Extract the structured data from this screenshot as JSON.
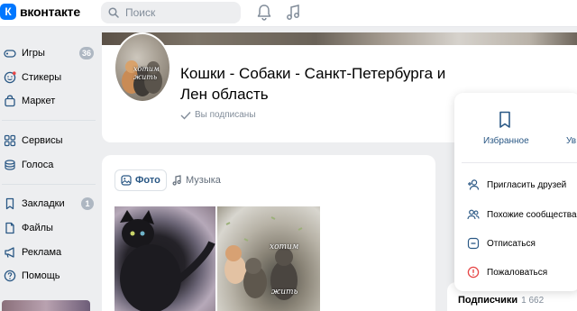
{
  "header": {
    "logo_text": "вконтакте",
    "logo_letter": "К",
    "search_placeholder": "Поиск"
  },
  "sidebar": {
    "items": [
      {
        "label": "Игры",
        "count": "36"
      },
      {
        "label": "Стикеры",
        "count": ""
      },
      {
        "label": "Маркет",
        "count": ""
      },
      {
        "label": "Сервисы",
        "count": ""
      },
      {
        "label": "Голоса",
        "count": ""
      },
      {
        "label": "Закладки",
        "count": "1"
      },
      {
        "label": "Файлы",
        "count": ""
      },
      {
        "label": "Реклама",
        "count": ""
      },
      {
        "label": "Помощь",
        "count": ""
      }
    ]
  },
  "community": {
    "title": "Кошки - Собаки - Санкт-Петербурга и Лен область",
    "subscribed_label": "Вы подписаны",
    "avatar_text": "хотим жить"
  },
  "popup": {
    "favorite_label": "Избранное",
    "second_label": "Ув",
    "items": [
      {
        "label": "Пригласить друзей",
        "icon": "add-user-icon",
        "color": "#2a5885"
      },
      {
        "label": "Похожие сообщества",
        "icon": "users-icon",
        "color": "#2a5885"
      },
      {
        "label": "Отписаться",
        "icon": "unsubscribe-icon",
        "color": "#2a5885"
      },
      {
        "label": "Пожаловаться",
        "icon": "report-icon",
        "color": "#e64646"
      }
    ]
  },
  "posts": {
    "tabs": [
      {
        "label": "Фото",
        "active": true
      },
      {
        "label": "Музыка",
        "active": false
      }
    ],
    "photo2_text": [
      "хотим",
      "жить"
    ]
  },
  "followers": {
    "label": "Подписчики",
    "count": "1 662"
  },
  "colors": {
    "accent": "#0077ff",
    "link": "#2a5885",
    "background": "#edeef0",
    "danger": "#e64646"
  }
}
